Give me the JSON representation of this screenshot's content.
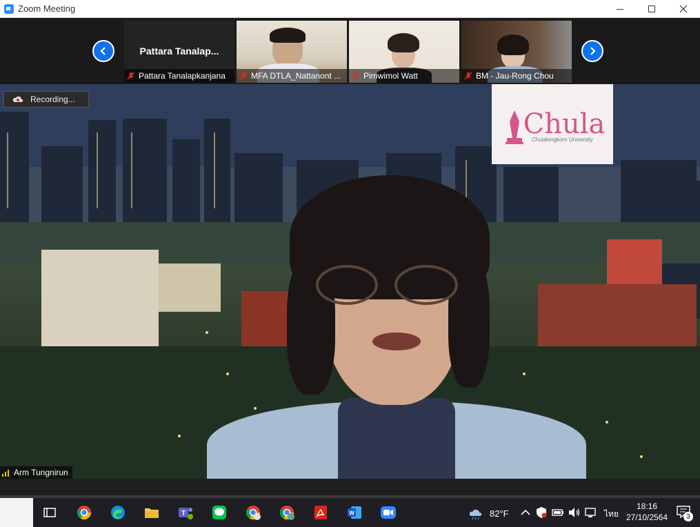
{
  "window": {
    "title": "Zoom Meeting"
  },
  "gallery": {
    "tiles": [
      {
        "big_name": "Pattara  Tanalap...",
        "name": "Pattara Tanalapkanjana"
      },
      {
        "name": "MFA DTLA_Nattanont ..."
      },
      {
        "name": "Pimwimol Watt"
      },
      {
        "name": "BM - Jau-Rong Chou"
      }
    ]
  },
  "main": {
    "recording_label": "Recording...",
    "logo_word": "Chula",
    "logo_sub": "Chulalongkorn University",
    "speaker_name": "Arm Tungnirun"
  },
  "taskbar": {
    "weather": "82°F",
    "lang": "ไทย",
    "time": "18:16",
    "date": "27/10/2564",
    "notification_count": "3"
  },
  "colors": {
    "zoom_blue": "#0e72ed",
    "chula_pink": "#d6558a",
    "taskbar": "#1e1e24"
  }
}
